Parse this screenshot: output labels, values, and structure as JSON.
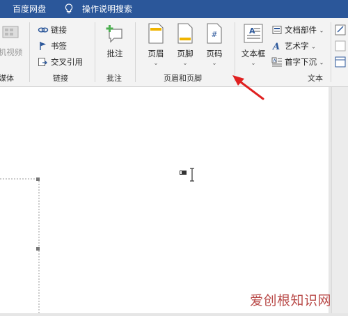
{
  "topbar": {
    "baidu_label": "百度网盘",
    "search_label": "操作说明搜索"
  },
  "ribbon": {
    "media_group": {
      "video_label": "机视频",
      "group_label": "媒体"
    },
    "links_group": {
      "link_label": "链接",
      "bookmark_label": "书签",
      "crossref_label": "交叉引用",
      "group_label": "链接"
    },
    "comments_group": {
      "comment_label": "批注",
      "group_label": "批注"
    },
    "header_footer_group": {
      "header_label": "页眉",
      "footer_label": "页脚",
      "page_number_label": "页码",
      "group_label": "页眉和页脚"
    },
    "text_group": {
      "textbox_label": "文本框",
      "docparts_label": "文档部件",
      "wordart_label": "艺术字",
      "dropcap_label": "首字下沉",
      "group_label": "文本"
    }
  },
  "watermark": "爱创根知识网",
  "colors": {
    "title_bar": "#2b579a",
    "arrow": "#e02020",
    "watermark": "#b94a48"
  }
}
